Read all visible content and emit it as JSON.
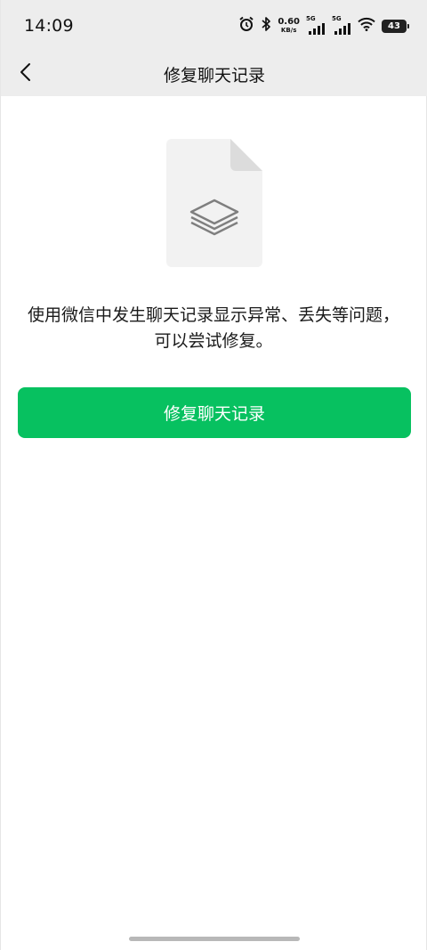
{
  "status_bar": {
    "time": "14:09",
    "net_speed_value": "0.60",
    "net_speed_unit": "KB/s",
    "sim1_label": "5G",
    "sim2_label": "5G",
    "battery_level": "43",
    "icons": [
      "alarm-icon",
      "bluetooth-icon",
      "signal-icon",
      "wifi-icon",
      "battery-icon"
    ]
  },
  "nav": {
    "back_icon": "chevron-left-icon",
    "title": "修复聊天记录"
  },
  "main": {
    "illustration_icon": "stacked-layers-document-icon",
    "description": "使用微信中发生聊天记录显示异常、丢失等问题，可以尝试修复。",
    "repair_button_label": "修复聊天记录"
  },
  "colors": {
    "accent": "#07c160",
    "header_bg": "#ededed",
    "doc_bg": "#f2f2f2"
  }
}
